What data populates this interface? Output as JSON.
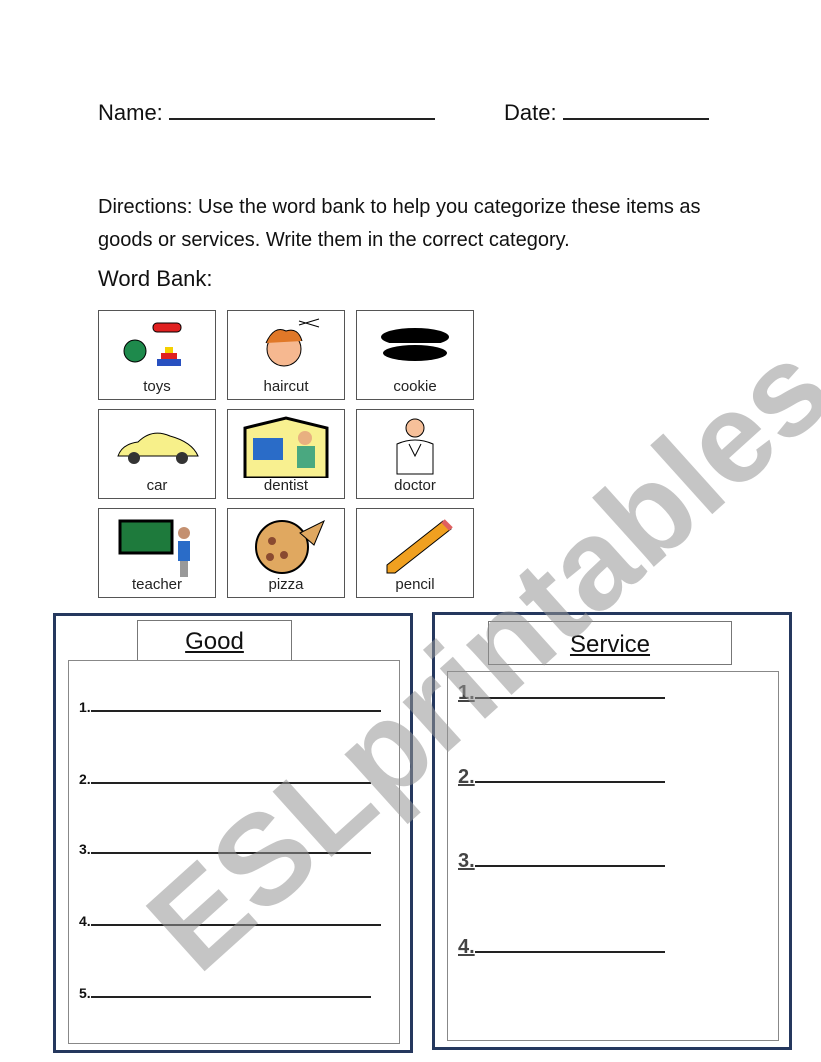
{
  "header": {
    "name_label": "Name:",
    "date_label": "Date:"
  },
  "directions": "Directions: Use the word bank to help you categorize these items as goods or services. Write them in the correct category.",
  "word_bank": {
    "label": "Word Bank:",
    "items": [
      {
        "label": "toys",
        "icon": "toys-icon"
      },
      {
        "label": "haircut",
        "icon": "haircut-icon"
      },
      {
        "label": "cookie",
        "icon": "cookie-icon"
      },
      {
        "label": "car",
        "icon": "car-icon"
      },
      {
        "label": "dentist",
        "icon": "dentist-icon"
      },
      {
        "label": "doctor",
        "icon": "doctor-icon"
      },
      {
        "label": "teacher",
        "icon": "teacher-icon"
      },
      {
        "label": "pizza",
        "icon": "pizza-icon"
      },
      {
        "label": "pencil",
        "icon": "pencil-icon"
      }
    ]
  },
  "good": {
    "title": "Good",
    "items": [
      "1.",
      "2.",
      "3.",
      "4.",
      "5."
    ]
  },
  "service": {
    "title": "Service",
    "items": [
      "1.",
      "2.",
      "3.",
      "4."
    ]
  },
  "watermark": "ESLprintables.com",
  "colors": {
    "panel_border": "#25385e"
  }
}
